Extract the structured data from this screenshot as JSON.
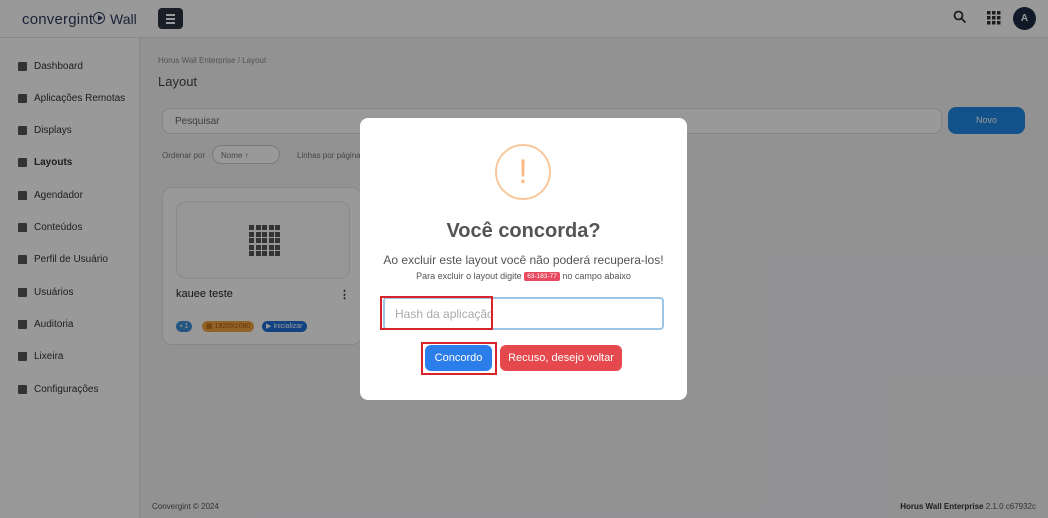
{
  "header": {
    "brand": "convergint",
    "app_name": "Wall",
    "avatar_initial": "A"
  },
  "sidebar": {
    "items": [
      {
        "label": "Dashboard",
        "icon": "dashboard-icon"
      },
      {
        "label": "Aplicações Remotas",
        "icon": "remote-apps-icon"
      },
      {
        "label": "Displays",
        "icon": "displays-icon"
      },
      {
        "label": "Layouts",
        "icon": "layouts-icon",
        "active": true
      },
      {
        "label": "Agendador",
        "icon": "calendar-icon"
      },
      {
        "label": "Conteúdos",
        "icon": "content-icon"
      },
      {
        "label": "Perfil de Usuário",
        "icon": "key-icon"
      },
      {
        "label": "Usuários",
        "icon": "users-icon"
      },
      {
        "label": "Auditoria",
        "icon": "flag-icon"
      },
      {
        "label": "Lixeira",
        "icon": "trash-icon"
      },
      {
        "label": "Configurações",
        "icon": "gear-icon"
      }
    ]
  },
  "main": {
    "breadcrumb": "Horus Wall Enterprise  /  Layout",
    "title": "Layout",
    "search_placeholder": "Pesquisar",
    "new_button": "Novo",
    "order_label": "Ordenar por",
    "order_value": "Nome ↑",
    "lines_label": "Linhas por página"
  },
  "card": {
    "name": "kauee teste",
    "badge_count": "1",
    "badge_resolution": "1920X1080",
    "badge_action": "Inicializar"
  },
  "footer": {
    "left": "Convergint © 2024",
    "product": "Horus Wall Enterprise",
    "version": "2.1.0 c67932c"
  },
  "modal": {
    "title": "Você concorda?",
    "text": "Ao excluir este layout você não poderá recupera-los!",
    "sub_before": "Para excluir o layout digite",
    "hash": "63-183-77",
    "sub_after": "no campo abaixo",
    "input_placeholder": "Hash da aplicação",
    "confirm": "Concordo",
    "cancel": "Recuso, desejo voltar",
    "warning_glyph": "!"
  },
  "colors": {
    "primary": "#1e88e5",
    "danger": "#e5484d",
    "warning": "#f8bb86"
  }
}
